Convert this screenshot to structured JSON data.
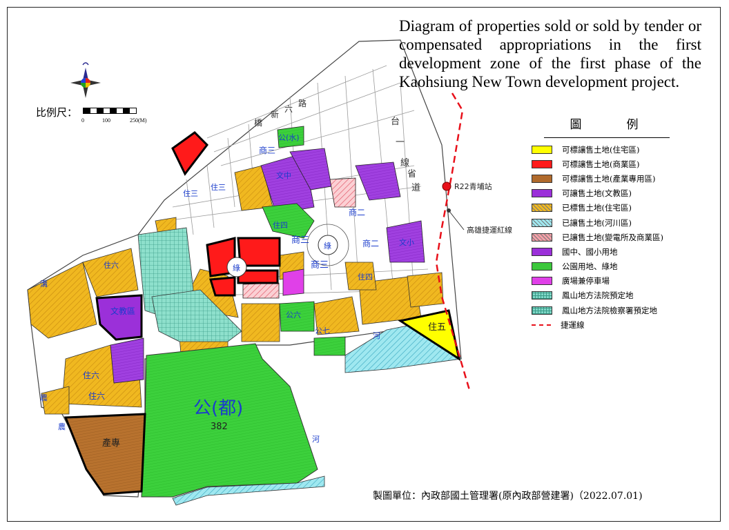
{
  "title": "Diagram of properties sold or sold by tender or compensated appropriations in the first development zone of the first phase of the Kaohsiung New Town development project.",
  "scale": {
    "label": "比例尺：",
    "ticks": [
      "0",
      "100",
      "250(M)"
    ]
  },
  "legend": {
    "title": "圖　例",
    "items": [
      {
        "label": "可標讓售土地(住宅區)",
        "color": "#ffff00",
        "pattern": "solid"
      },
      {
        "label": "可標讓售土地(商業區)",
        "color": "#ff1a1a",
        "pattern": "solid"
      },
      {
        "label": "可標讓售土地(產業專用區)",
        "color": "#b06a2c",
        "pattern": "solid"
      },
      {
        "label": "可讓售土地(文教區)",
        "color": "#9b30d9",
        "pattern": "solid"
      },
      {
        "label": "已標售土地(住宅區)",
        "color": "#f0b820",
        "pattern": "hatch"
      },
      {
        "label": "已讓售土地(河川區)",
        "color": "#9fe8f0",
        "pattern": "hatch"
      },
      {
        "label": "已讓售土地(變電所及商業區)",
        "color": "#f4a0a8",
        "pattern": "hatch"
      },
      {
        "label": "國中、國小用地",
        "color": "#9b30d9",
        "pattern": "solid"
      },
      {
        "label": "公園用地、綠地",
        "color": "#3cc83c",
        "pattern": "solid"
      },
      {
        "label": "廣場兼停車場",
        "color": "#e040e8",
        "pattern": "solid"
      },
      {
        "label": "鳳山地方法院預定地",
        "color": "#7fd8c8",
        "pattern": "grid"
      },
      {
        "label": "鳳山地方法院檢察署預定地",
        "color": "#7fd8c8",
        "pattern": "grid"
      },
      {
        "label": "捷運線",
        "color": "#e8101a",
        "pattern": "dash"
      }
    ]
  },
  "map": {
    "road_names": [
      "橋",
      "新",
      "六",
      "路",
      "台",
      "一",
      "線",
      "省",
      "道"
    ],
    "station": "R22青埔站",
    "line_label": "高雄捷運紅線",
    "zone_labels": {
      "park_main": "公(都)",
      "park_main_no": "382",
      "industrial": "產專",
      "school_west": "文教區",
      "residential_five": "住五",
      "commercial_three": "商三",
      "green_line": "綠",
      "river": "河",
      "farm": "農",
      "park_water": "公(水)",
      "commercial_two": "商二",
      "school_culture": "文中",
      "small_school": "文小",
      "res_six": "住六",
      "res_three": "住三",
      "res_four": "住四",
      "park_six": "公六",
      "park_seven": "公七",
      "ditch": "溝"
    }
  },
  "credit": "製圖單位：內政部國土管理署(原內政部營建署)（2022.07.01)"
}
